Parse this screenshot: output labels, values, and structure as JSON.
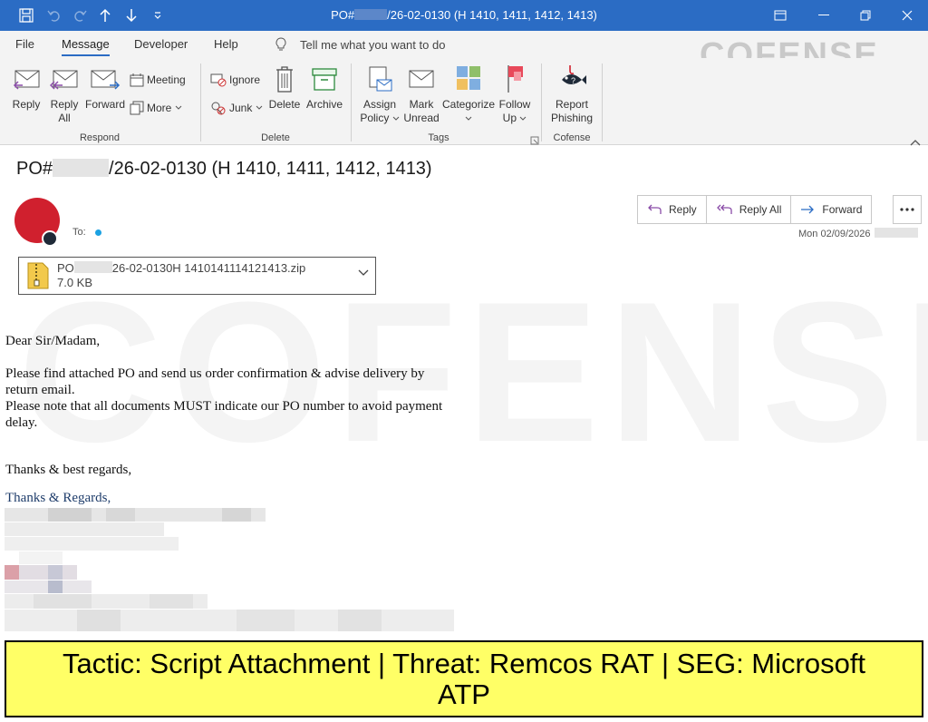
{
  "window": {
    "title_prefix": "PO#",
    "title_suffix": "/26-02-0130 (H 1410, 1411, 1412, 1413)"
  },
  "menu": {
    "tabs": [
      "File",
      "Message",
      "Developer",
      "Help"
    ],
    "active_tab": "Message",
    "tell_me": "Tell me what you want to do"
  },
  "brand": {
    "logo_text": "COFENSE"
  },
  "ribbon": {
    "respond": {
      "label": "Respond",
      "reply": "Reply",
      "reply_all_line1": "Reply",
      "reply_all_line2": "All",
      "forward": "Forward",
      "meeting": "Meeting",
      "more": "More"
    },
    "delete": {
      "label": "Delete",
      "ignore": "Ignore",
      "junk": "Junk",
      "delete": "Delete",
      "archive": "Archive"
    },
    "tags": {
      "label": "Tags",
      "assign_line1": "Assign",
      "assign_line2": "Policy",
      "mark_line1": "Mark",
      "mark_line2": "Unread",
      "categorize": "Categorize",
      "follow_line1": "Follow",
      "follow_line2": "Up"
    },
    "cofense": {
      "label": "Cofense",
      "report_line1": "Report",
      "report_line2": "Phishing"
    }
  },
  "message": {
    "subject_prefix": "PO#",
    "subject_suffix": "/26-02-0130 (H 1410, 1411, 1412, 1413)",
    "to_label": "To:",
    "actions": {
      "reply": "Reply",
      "reply_all": "Reply All",
      "forward": "Forward"
    },
    "date": "Mon 02/09/2026",
    "attachment": {
      "name_prefix": "PO",
      "name_suffix": "26-02-0130H 1410141114121413.zip",
      "size": "7.0 KB"
    },
    "body": {
      "greeting": "Dear Sir/Madam,",
      "line1": "Please find attached PO and send us order confirmation & advise delivery by",
      "line2": "return email.",
      "line3": "Please note that all documents MUST indicate our PO number to avoid payment",
      "line4": "delay.",
      "closing": "Thanks & best regards,",
      "signature_name": "Thanks & Regards,"
    }
  },
  "banner": {
    "line1": "Tactic: Script Attachment | Threat: Remcos RAT | SEG: Microsoft",
    "line2": "ATP"
  },
  "colors": {
    "titlebar": "#2b6cc4",
    "avatar": "#d0202e",
    "banner_bg": "#ffff66"
  }
}
